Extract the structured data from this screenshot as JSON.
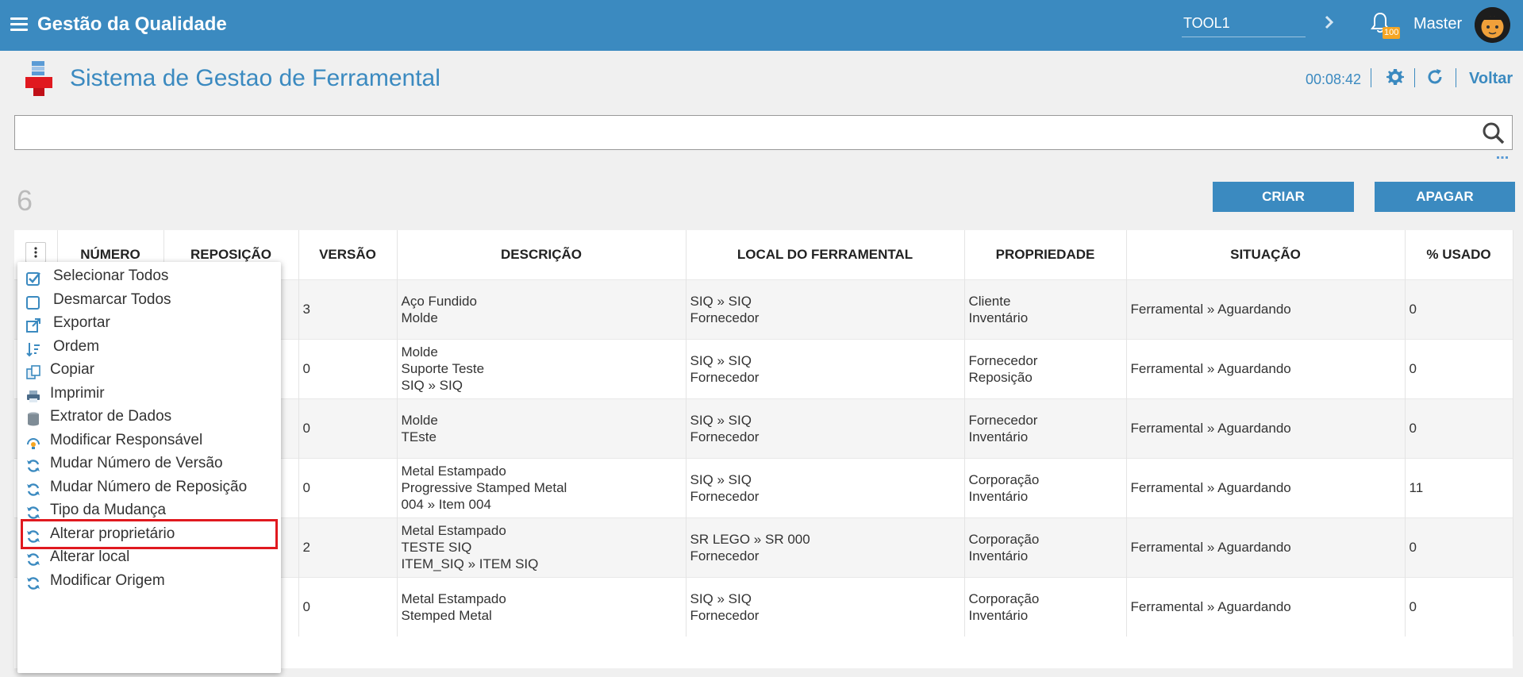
{
  "topbar": {
    "app_title": "Gestão da Qualidade",
    "database_value": "TOOL1",
    "notification_count": "100",
    "user_name": "Master"
  },
  "header": {
    "page_title": "Sistema de Gestao de Ferramental",
    "timer": "00:08:42",
    "back_label": "Voltar"
  },
  "search": {
    "value": "",
    "placeholder": ""
  },
  "record_count": "6",
  "actions": {
    "create_label": "CRIAR",
    "delete_label": "APAGAR"
  },
  "table": {
    "columns": [
      "NÚMERO",
      "REPOSIÇÃO",
      "VERSÃO",
      "DESCRIÇÃO",
      "LOCAL DO FERRAMENTAL",
      "PROPRIEDADE",
      "SITUAÇÃO",
      "% USADO"
    ],
    "rows": [
      {
        "versao": "3",
        "descricao": [
          "Aço Fundido",
          "Molde"
        ],
        "local": [
          "SIQ » SIQ",
          "Fornecedor"
        ],
        "propriedade": [
          "Cliente",
          "Inventário"
        ],
        "situacao": "Ferramental » Aguardando",
        "usado": "0"
      },
      {
        "versao": "0",
        "descricao": [
          "Molde",
          "Suporte Teste",
          "SIQ » SIQ"
        ],
        "local": [
          "SIQ » SIQ",
          "Fornecedor"
        ],
        "propriedade": [
          "Fornecedor",
          "Reposição"
        ],
        "situacao": "Ferramental » Aguardando",
        "usado": "0"
      },
      {
        "versao": "0",
        "descricao": [
          "Molde",
          "TEste"
        ],
        "local": [
          "SIQ » SIQ",
          "Fornecedor"
        ],
        "propriedade": [
          "Fornecedor",
          "Inventário"
        ],
        "situacao": "Ferramental » Aguardando",
        "usado": "0"
      },
      {
        "versao": "0",
        "descricao": [
          "Metal Estampado",
          "Progressive Stamped Metal",
          "004 » Item 004"
        ],
        "local": [
          "SIQ » SIQ",
          "Fornecedor"
        ],
        "propriedade": [
          "Corporação",
          "Inventário"
        ],
        "situacao": "Ferramental » Aguardando",
        "usado": "11"
      },
      {
        "versao": "2",
        "descricao": [
          "Metal Estampado",
          "TESTE SIQ",
          "ITEM_SIQ » ITEM SIQ"
        ],
        "local": [
          "SR LEGO » SR 000",
          "Fornecedor"
        ],
        "propriedade": [
          "Corporação",
          "Inventário"
        ],
        "situacao": "Ferramental » Aguardando",
        "usado": "0"
      },
      {
        "versao": "0",
        "descricao": [
          "Metal Estampado",
          "Stemped Metal"
        ],
        "local": [
          "SIQ » SIQ",
          "Fornecedor"
        ],
        "propriedade": [
          "Corporação",
          "Inventário"
        ],
        "situacao": "Ferramental » Aguardando",
        "usado": "0"
      }
    ]
  },
  "context_menu": {
    "items": [
      {
        "label": "Selecionar Todos",
        "icon": "checkbox-checked-icon"
      },
      {
        "label": "Desmarcar Todos",
        "icon": "checkbox-empty-icon"
      },
      {
        "label": "Exportar",
        "icon": "external-link-icon"
      },
      {
        "label": "Ordem",
        "icon": "sort-icon"
      },
      {
        "label": "Copiar",
        "icon": "copy-icon"
      },
      {
        "label": "Imprimir",
        "icon": "printer-icon"
      },
      {
        "label": "Extrator de Dados",
        "icon": "database-icon"
      },
      {
        "label": "Modificar Responsável",
        "icon": "user-change-icon"
      },
      {
        "label": "Mudar Número de Versão",
        "icon": "sync-icon"
      },
      {
        "label": "Mudar Número de Reposição",
        "icon": "sync-icon"
      },
      {
        "label": "Tipo da Mudança",
        "icon": "sync-icon"
      },
      {
        "label": "Alterar proprietário",
        "icon": "sync-icon"
      },
      {
        "label": "Alterar local",
        "icon": "sync-icon"
      },
      {
        "label": "Modificar Origem",
        "icon": "sync-icon"
      }
    ]
  },
  "colors": {
    "primary": "#3b8ac0",
    "highlight_border": "#e0191f",
    "badge": "#f5a623"
  }
}
